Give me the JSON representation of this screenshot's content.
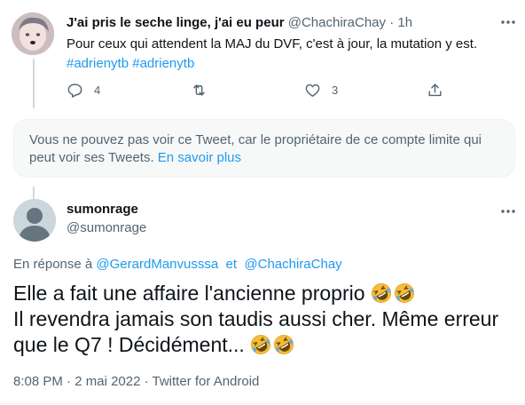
{
  "parent_tweet": {
    "display_name": "J'ai pris le seche linge, j'ai eu peur",
    "handle": "@ChachiraChay",
    "separator": "·",
    "time": "1h",
    "text": "Pour ceux qui attendent la MAJ du DVF, c'est à jour, la mutation y est.",
    "hashtags": [
      "#adrienytb",
      "#adrienytb"
    ],
    "reply_count": "4",
    "like_count": "3"
  },
  "withheld_notice": {
    "text": "Vous ne pouvez pas voir ce Tweet, car le propriétaire de ce compte limite qui peut voir ses Tweets.",
    "link": "En savoir plus"
  },
  "main_tweet": {
    "display_name": "sumonrage",
    "handle": "@sumonrage",
    "reply_prefix": "En réponse à",
    "reply_to_1": "@GerardManvusssa",
    "reply_join": "et",
    "reply_to_2": "@ChachiraChay",
    "text_line1": "Elle a fait une affaire l'ancienne proprio",
    "text_line2": "Il revendra jamais son taudis aussi cher. Même erreur que le Q7 ! Décidément...",
    "emoji": "rolling-on-the-floor-laughing",
    "time": "8:08 PM",
    "date": "2 mai 2022",
    "source": "Twitter for Android",
    "meta_sep": "·"
  },
  "colors": {
    "link": "#1d9bf0",
    "muted": "#536471",
    "text": "#0f1419",
    "notice_bg": "#f7f9f9"
  }
}
